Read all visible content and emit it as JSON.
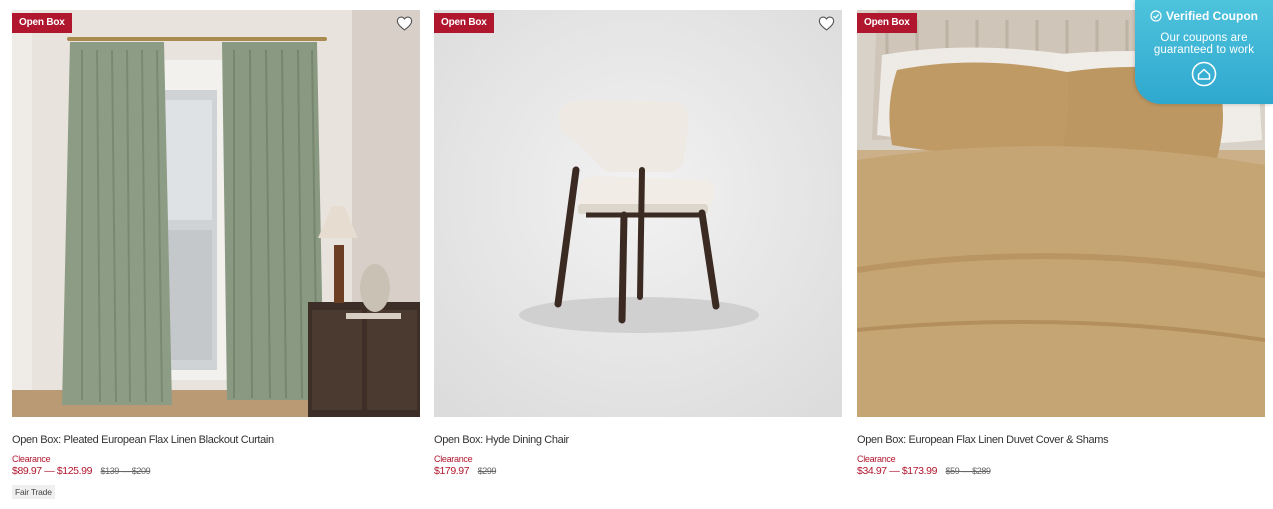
{
  "products": [
    {
      "badge": "Open Box",
      "image_alt": "Sage green linen curtains hanging by a bright window",
      "title": "Open Box: Pleated European Flax Linen Blackout Curtain",
      "clearance_label": "Clearance",
      "sale_price": "$89.97 — $125.99",
      "original_price": "$139 — $209",
      "tag": "Fair Trade"
    },
    {
      "badge": "Open Box",
      "image_alt": "Cream upholstered dining chair with dark wood legs",
      "title": "Open Box: Hyde Dining Chair",
      "clearance_label": "Clearance",
      "sale_price": "$179.97",
      "original_price": "$299",
      "tag": null
    },
    {
      "badge": "Open Box",
      "image_alt": "Camel linen duvet cover and shams on a bed",
      "title": "Open Box: European Flax Linen Duvet Cover & Shams",
      "clearance_label": "Clearance",
      "sale_price": "$34.97 — $173.99",
      "original_price": "$59 — $289",
      "tag": null
    }
  ],
  "coupon_widget": {
    "heading": "Verified Coupon",
    "line1": "Our coupons are",
    "line2": "guaranteed to work"
  },
  "colors": {
    "accent_red": "#b0172f",
    "coupon_blue": "#3bb3d6"
  },
  "icons": [
    "heart-icon",
    "check-circle-icon",
    "coupon-logo-icon"
  ]
}
